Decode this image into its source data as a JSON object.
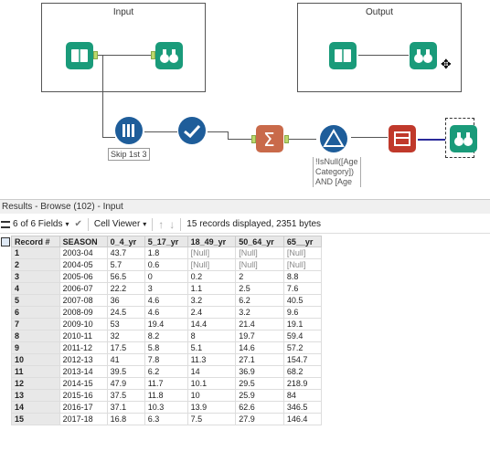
{
  "canvas": {
    "input_container_title": "Input",
    "output_container_title": "Output",
    "skip_annotation": "Skip 1st 3",
    "filter_formula": "!IsNull([Age\nCategory])\nAND [Age"
  },
  "results": {
    "header": "Results - Browse (102) - Input",
    "fields_label": "6 of 6 Fields",
    "viewer_label": "Cell Viewer",
    "records_label": "15 records displayed, 2351 bytes",
    "columns": [
      "Record #",
      "SEASON",
      "0_4_yr",
      "5_17_yr",
      "18_49_yr",
      "50_64_yr",
      "65__yr"
    ],
    "rows": [
      [
        "1",
        "2003-04",
        "43.7",
        "1.8",
        "[Null]",
        "[Null]",
        "[Null]"
      ],
      [
        "2",
        "2004-05",
        "5.7",
        "0.6",
        "[Null]",
        "[Null]",
        "[Null]"
      ],
      [
        "3",
        "2005-06",
        "56.5",
        "0",
        "0.2",
        "2",
        "8.8"
      ],
      [
        "4",
        "2006-07",
        "22.2",
        "3",
        "1.1",
        "2.5",
        "7.6"
      ],
      [
        "5",
        "2007-08",
        "36",
        "4.6",
        "3.2",
        "6.2",
        "40.5"
      ],
      [
        "6",
        "2008-09",
        "24.5",
        "4.6",
        "2.4",
        "3.2",
        "9.6"
      ],
      [
        "7",
        "2009-10",
        "53",
        "19.4",
        "14.4",
        "21.4",
        "19.1"
      ],
      [
        "8",
        "2010-11",
        "32",
        "8.2",
        "8",
        "19.7",
        "59.4"
      ],
      [
        "9",
        "2011-12",
        "17.5",
        "5.8",
        "5.1",
        "14.6",
        "57.2"
      ],
      [
        "10",
        "2012-13",
        "41",
        "7.8",
        "11.3",
        "27.1",
        "154.7"
      ],
      [
        "11",
        "2013-14",
        "39.5",
        "6.2",
        "14",
        "36.9",
        "68.2"
      ],
      [
        "12",
        "2014-15",
        "47.9",
        "11.7",
        "10.1",
        "29.5",
        "218.9"
      ],
      [
        "13",
        "2015-16",
        "37.5",
        "11.8",
        "10",
        "25.9",
        "84"
      ],
      [
        "14",
        "2016-17",
        "37.1",
        "10.3",
        "13.9",
        "62.6",
        "346.5"
      ],
      [
        "15",
        "2017-18",
        "16.8",
        "6.3",
        "7.5",
        "27.9",
        "146.4"
      ]
    ]
  }
}
